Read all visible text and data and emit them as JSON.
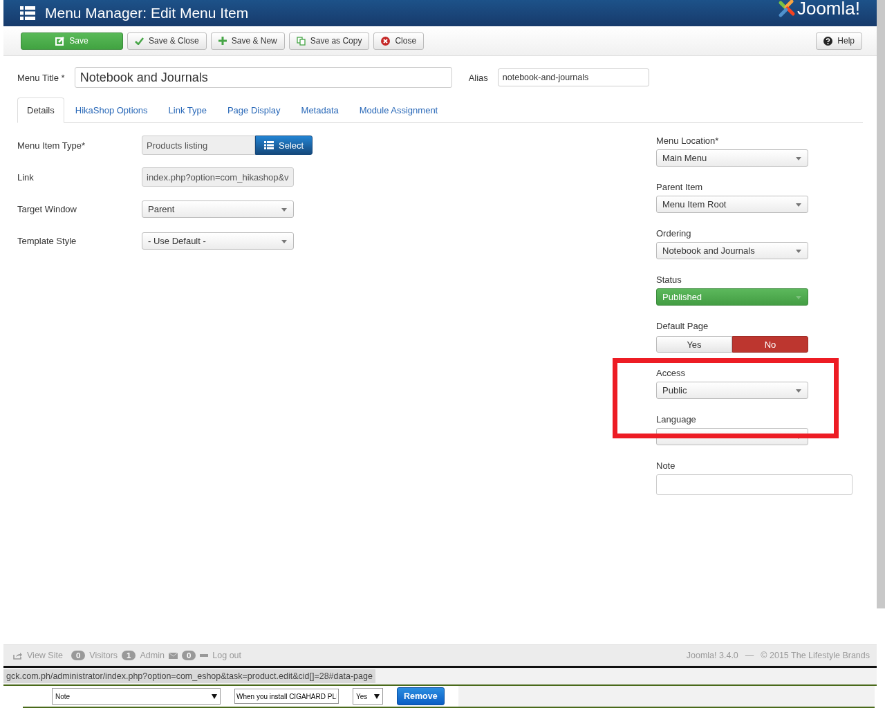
{
  "header": {
    "title": "Menu Manager: Edit Menu Item",
    "logo": "Joomla!"
  },
  "toolbar": {
    "buttons": [
      {
        "label": "Save",
        "kind": "save"
      },
      {
        "label": "Save & Close",
        "kind": "check"
      },
      {
        "label": "Save & New",
        "kind": "plus"
      },
      {
        "label": "Save as Copy",
        "kind": "copy"
      },
      {
        "label": "Close",
        "kind": "close"
      }
    ],
    "help": "Help"
  },
  "menu_title": {
    "label": "Menu Title",
    "mark": "*",
    "value": "Notebook and Journals"
  },
  "alias": {
    "label": "Alias",
    "value": "notebook-and-journals"
  },
  "tabs": [
    {
      "label": "Details",
      "selected": true
    },
    {
      "label": "HikaShop Options",
      "selected": false
    },
    {
      "label": "Link Type",
      "selected": false
    },
    {
      "label": "Page Display",
      "selected": false
    },
    {
      "label": "Metadata",
      "selected": false
    },
    {
      "label": "Module Assignment",
      "selected": false
    }
  ],
  "left_fields": [
    {
      "label": "Menu Item Type",
      "mark": "*",
      "kind": "type",
      "value": "Products listing",
      "button": "Select"
    },
    {
      "label": "Link",
      "kind": "readonly",
      "value": "index.php?option=com_hikashop&v"
    },
    {
      "label": "Target Window",
      "kind": "select",
      "value": "Parent"
    },
    {
      "label": "Template Style",
      "kind": "select",
      "value": "- Use Default -"
    }
  ],
  "right_fields": [
    {
      "label": "Menu Location",
      "mark": "*",
      "kind": "select",
      "value": "Main Menu"
    },
    {
      "label": "Parent Item",
      "kind": "select",
      "value": "Menu Item Root"
    },
    {
      "label": "Ordering",
      "kind": "select",
      "value": "Notebook and Journals"
    },
    {
      "label": "Status",
      "kind": "status",
      "value": "Published"
    },
    {
      "label": "Default Page",
      "kind": "toggle",
      "options": [
        {
          "label": "Yes",
          "selected": false
        },
        {
          "label": "No",
          "selected": true
        }
      ]
    },
    {
      "label": "Access",
      "kind": "select",
      "value": "Public"
    },
    {
      "label": "Language",
      "kind": "select"
    },
    {
      "label": "Note",
      "kind": "text"
    }
  ],
  "footer": {
    "view_site": "View Site",
    "visitors_count": "0",
    "visitors": "Visitors",
    "admin_count": "1",
    "admin": "Admin",
    "messages_count": "0",
    "logout": "Log out",
    "version": "Joomla! 3.4.0",
    "separator": "—",
    "copyright": "© 2015 The Lifestyle Brands"
  },
  "status_url": "gck.com.ph/administrator/index.php?option=com_eshop&task=product.edit&cid[]=28#data-page",
  "bottom_row": {
    "select": "Note",
    "input": "When you install CIGAHARD PLI",
    "choice": "Yes",
    "button": "Remove"
  }
}
